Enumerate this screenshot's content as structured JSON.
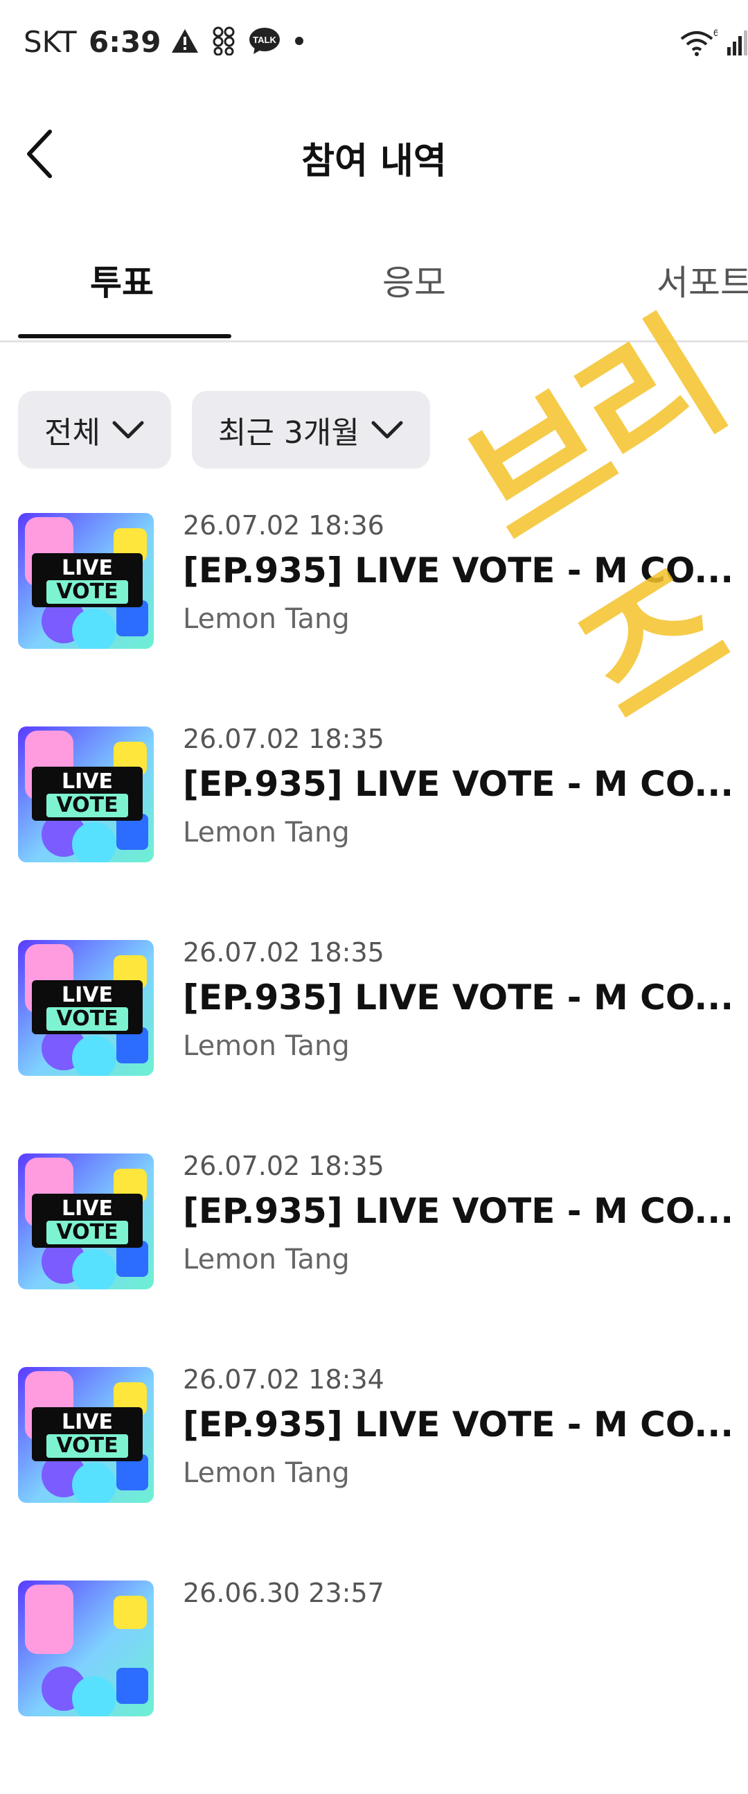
{
  "status_bar": {
    "carrier": "SKT",
    "time": "6:39",
    "icons": [
      "warning-icon",
      "app-icon",
      "talk-icon",
      "dot-icon"
    ],
    "talk_label": "TALK",
    "right_icons": [
      "wifi-icon",
      "signal-icon"
    ],
    "wifi_label": "6"
  },
  "header": {
    "title": "참여 내역",
    "back_icon": "chevron-left-icon"
  },
  "tabs": [
    {
      "label": "투표",
      "active": true
    },
    {
      "label": "응모",
      "active": false
    },
    {
      "label": "서포트",
      "active": false
    }
  ],
  "filters": [
    {
      "label": "전체",
      "icon": "chevron-down-icon"
    },
    {
      "label": "최근 3개월",
      "icon": "chevron-down-icon"
    }
  ],
  "watermark": "브리즈",
  "list": [
    {
      "date": "26.07.02 18:36",
      "title": "[EP.935] LIVE VOTE - M CO...",
      "artist": "Lemon Tang",
      "thumb_line1": "LIVE",
      "thumb_line2": "VOTE"
    },
    {
      "date": "26.07.02 18:35",
      "title": "[EP.935] LIVE VOTE - M CO...",
      "artist": "Lemon Tang",
      "thumb_line1": "LIVE",
      "thumb_line2": "VOTE"
    },
    {
      "date": "26.07.02 18:35",
      "title": "[EP.935] LIVE VOTE - M CO...",
      "artist": "Lemon Tang",
      "thumb_line1": "LIVE",
      "thumb_line2": "VOTE"
    },
    {
      "date": "26.07.02 18:35",
      "title": "[EP.935] LIVE VOTE - M CO...",
      "artist": "Lemon Tang",
      "thumb_line1": "LIVE",
      "thumb_line2": "VOTE"
    },
    {
      "date": "26.07.02 18:34",
      "title": "[EP.935] LIVE VOTE - M CO...",
      "artist": "Lemon Tang",
      "thumb_line1": "LIVE",
      "thumb_line2": "VOTE"
    },
    {
      "date": "26.06.30 23:57",
      "title": "",
      "artist": "",
      "thumb_line1": "",
      "thumb_line2": ""
    }
  ],
  "colors": {
    "accent_underline": "#111111",
    "chip_bg": "#ececf0",
    "watermark": "#f4c22a"
  }
}
